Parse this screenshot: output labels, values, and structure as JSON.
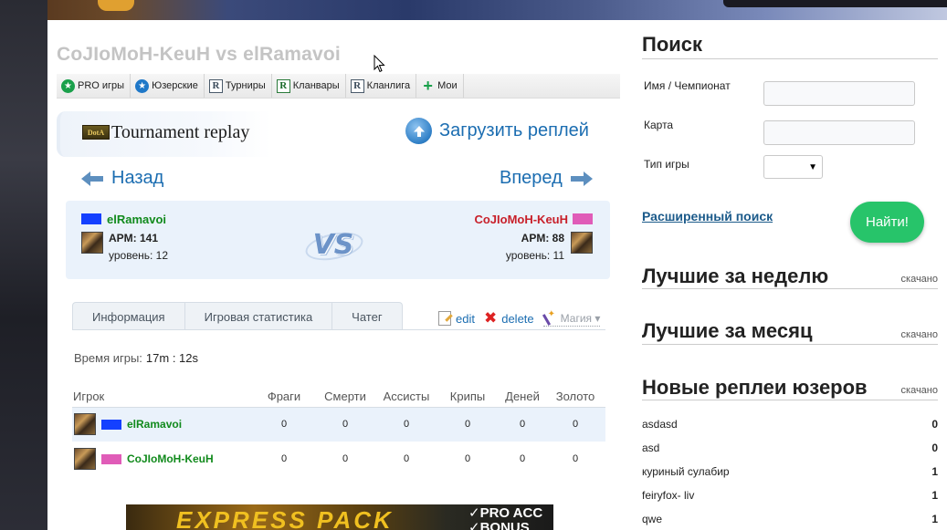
{
  "match": {
    "title": "CoJIoMoH-KeuH vs elRamavoi"
  },
  "categories": [
    {
      "label": "PRO игры",
      "icon": "star-green-icon"
    },
    {
      "label": "Юзерские",
      "icon": "star-blue-icon"
    },
    {
      "label": "Турниры",
      "icon": "r-icon"
    },
    {
      "label": "Кланвары",
      "icon": "r-green-icon"
    },
    {
      "label": "Кланлига",
      "icon": "r-icon"
    },
    {
      "label": "Мои",
      "icon": "plus-icon"
    }
  ],
  "replay": {
    "logo": "DotA",
    "type": "Tournament replay",
    "upload_label": "Загрузить реплей",
    "back_label": "Назад",
    "forward_label": "Вперед"
  },
  "players": [
    {
      "name": "elRamavoi",
      "color": "#1440ff",
      "apm": "APM: 141",
      "level": "уровень: 12"
    },
    {
      "name": "CoJIoMoH-KeuH",
      "color": "#e05cb8",
      "apm": "APM: 88",
      "level": "уровень: 11"
    }
  ],
  "vs": "VS",
  "tabs": [
    "Информация",
    "Игровая статистика",
    "Чатег"
  ],
  "actions": {
    "edit": "edit",
    "delete": "delete",
    "magic": "Магия ▾"
  },
  "game_time": {
    "label": "Время игры:",
    "value": "17m : 12s"
  },
  "table": {
    "headers": [
      "Игрок",
      "Фраги",
      "Смерти",
      "Ассисты",
      "Крипы",
      "Деней",
      "Золото"
    ],
    "rows": [
      {
        "name": "elRamavoi",
        "color": "#1440ff",
        "values": [
          "0",
          "0",
          "0",
          "0",
          "0",
          "0"
        ]
      },
      {
        "name": "CoJIoMoH-KeuH",
        "color": "#e05cb8",
        "values": [
          "0",
          "0",
          "0",
          "0",
          "0",
          "0"
        ]
      }
    ]
  },
  "banner": {
    "text1": "EXPRESS PACK",
    "text2a": "✓PRO ACC",
    "text2b": "✓BONUS"
  },
  "sidebar": {
    "search_title": "Поиск",
    "name_label": "Имя / Чемпионат",
    "map_label": "Карта",
    "gametype_label": "Тип игры",
    "advanced": "Расширенный поиск",
    "find_button": "Найти!",
    "best_week": "Лучшие за неделю",
    "best_month": "Лучшие за месяц",
    "new_user": "Новые реплеи юзеров",
    "downloaded": "скачано",
    "user_replays": [
      {
        "name": "asdasd",
        "count": "0"
      },
      {
        "name": "asd",
        "count": "0"
      },
      {
        "name": "куриный сулабир",
        "count": "1"
      },
      {
        "name": "feiryfox- liv",
        "count": "1"
      },
      {
        "name": "qwe",
        "count": "1"
      }
    ]
  }
}
